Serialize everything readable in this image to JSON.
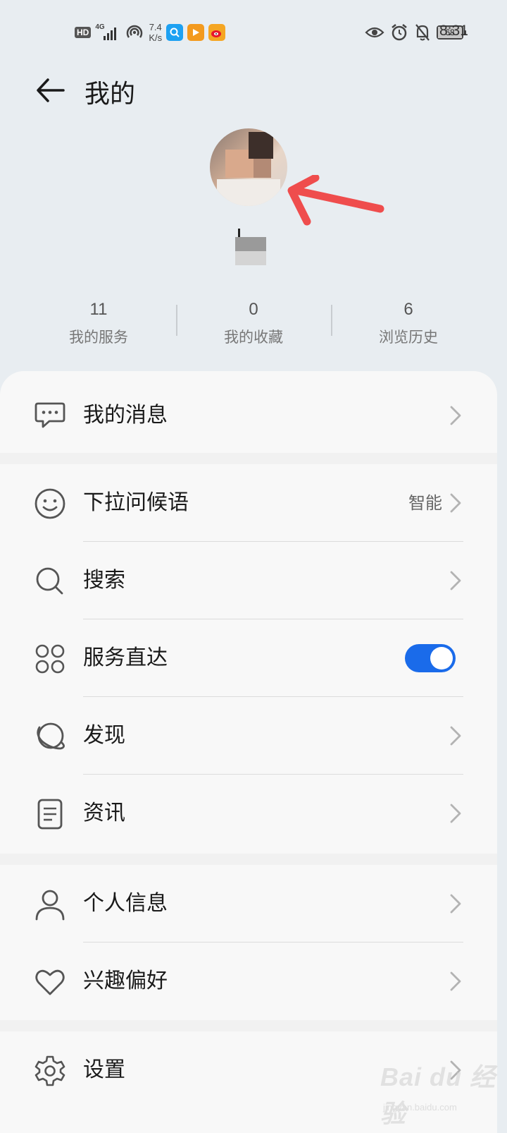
{
  "status_bar": {
    "hd": "HD",
    "network": "4G",
    "speed_value": "7.4",
    "speed_unit": "K/s",
    "battery": "68",
    "time": "8:31",
    "app_icons": [
      {
        "name": "search-app",
        "color": "#1da1f2"
      },
      {
        "name": "video-app",
        "color": "#f39a1e"
      },
      {
        "name": "weibo-app",
        "color": "#f5a623"
      }
    ]
  },
  "header": {
    "title": "我的"
  },
  "profile": {
    "annotation_color": "#ef4d4d"
  },
  "stats": [
    {
      "value": "11",
      "label": "我的服务"
    },
    {
      "value": "0",
      "label": "我的收藏"
    },
    {
      "value": "6",
      "label": "浏览历史"
    }
  ],
  "menu": {
    "messages": {
      "label": "我的消息",
      "icon": "chat-bubble-icon"
    },
    "greeting": {
      "label": "下拉问候语",
      "value": "智能",
      "icon": "smile-icon"
    },
    "search": {
      "label": "搜索",
      "icon": "search-icon"
    },
    "service": {
      "label": "服务直达",
      "icon": "grid-circles-icon",
      "toggle_on": true,
      "toggle_color": "#1a6bea"
    },
    "discover": {
      "label": "发现",
      "icon": "planet-icon"
    },
    "news": {
      "label": "资讯",
      "icon": "document-icon"
    },
    "personal": {
      "label": "个人信息",
      "icon": "person-icon"
    },
    "interests": {
      "label": "兴趣偏好",
      "icon": "heart-icon"
    },
    "settings": {
      "label": "设置",
      "icon": "gear-icon"
    }
  },
  "watermark": {
    "brand": "Bai du 经验",
    "url": "jingyan.baidu.com"
  }
}
